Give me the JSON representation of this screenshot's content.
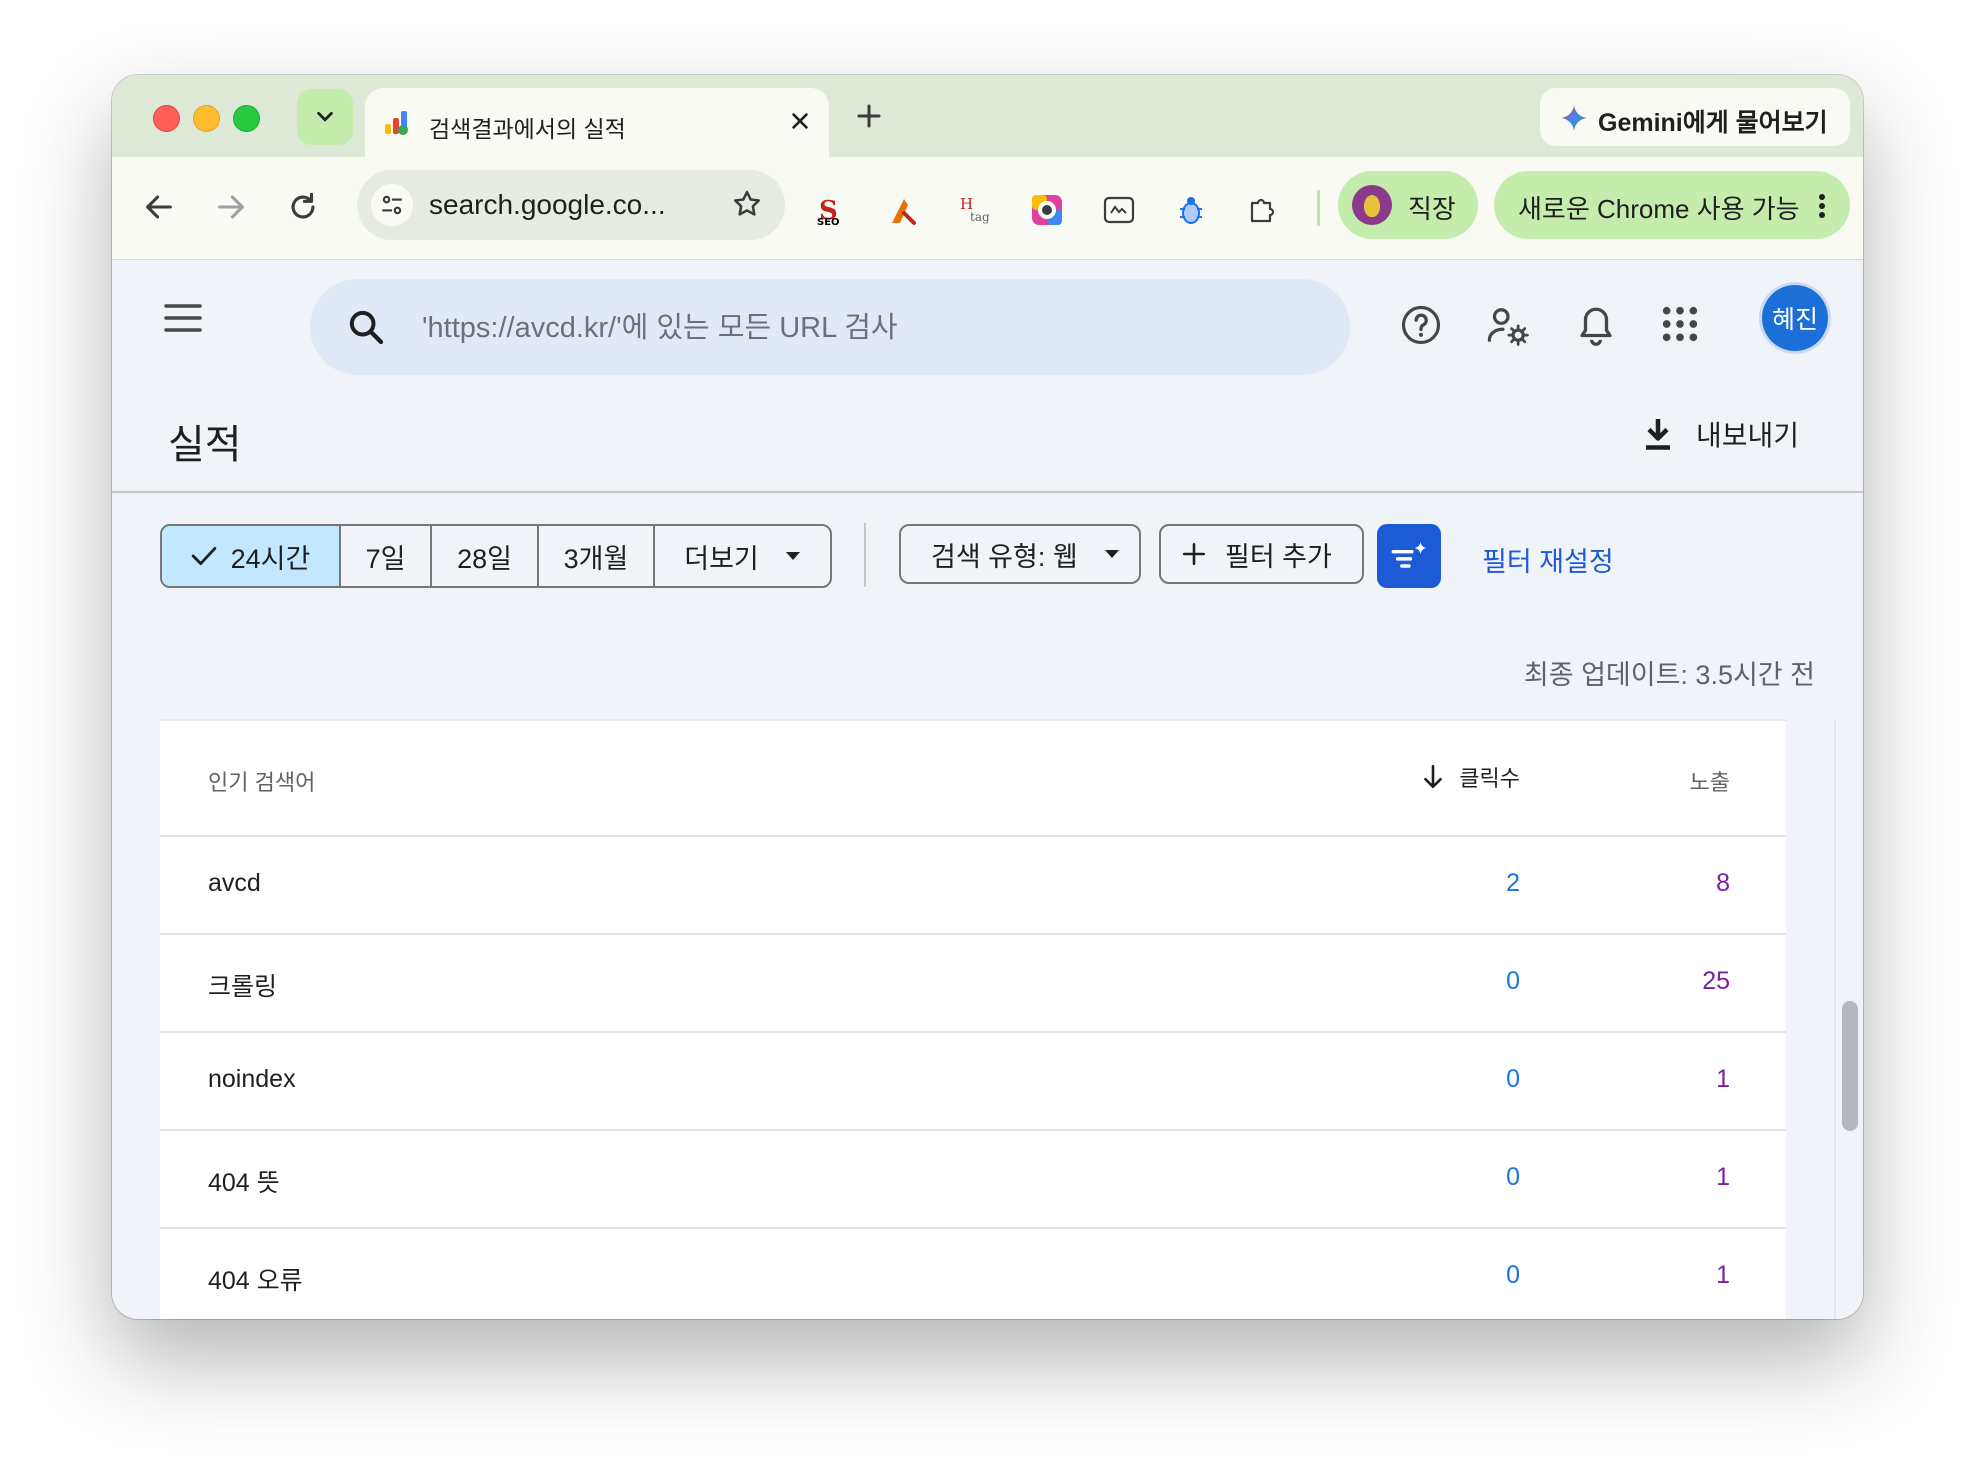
{
  "browser": {
    "tab": {
      "title": "검색결과에서의 실적"
    },
    "gemini_label": "Gemini에게 물어보기",
    "omnibox_url": "search.google.co...",
    "profile_label": "직장",
    "update_label": "새로운 Chrome 사용 가능",
    "extensions": [
      "seo-extension-icon",
      "tool-extension-icon",
      "htag-extension-icon",
      "color-extension-icon",
      "screenshot-extension-icon",
      "bug-extension-icon",
      "puzzle-icon"
    ]
  },
  "app": {
    "search_placeholder": "'https://avcd.kr/'에 있는 모든 URL 검사",
    "user_initials": "혜진",
    "page_title": "실적",
    "export_label": "내보내기"
  },
  "filters": {
    "ranges": [
      "24시간",
      "7일",
      "28일",
      "3개월"
    ],
    "more_label": "더보기",
    "active_range": "24시간",
    "search_type_label": "검색 유형: 웹",
    "add_filter_label": "필터 추가",
    "reset_label": "필터 재설정",
    "last_update": "최종 업데이트: 3.5시간 전"
  },
  "table": {
    "headers": {
      "query": "인기 검색어",
      "clicks": "클릭수",
      "impressions": "노출"
    },
    "rows": [
      {
        "query": "avcd",
        "clicks": "2",
        "impressions": "8"
      },
      {
        "query": "크롤링",
        "clicks": "0",
        "impressions": "25"
      },
      {
        "query": "noindex",
        "clicks": "0",
        "impressions": "1"
      },
      {
        "query": "404 뜻",
        "clicks": "0",
        "impressions": "1"
      },
      {
        "query": "404 오류",
        "clicks": "0",
        "impressions": "1"
      }
    ]
  },
  "colors": {
    "accent": "#1d5bd6",
    "clicks": "#1a73e8",
    "impressions": "#7b1fa2",
    "tab_strip": "#dde9d6",
    "chip_green": "#c4ecac"
  }
}
